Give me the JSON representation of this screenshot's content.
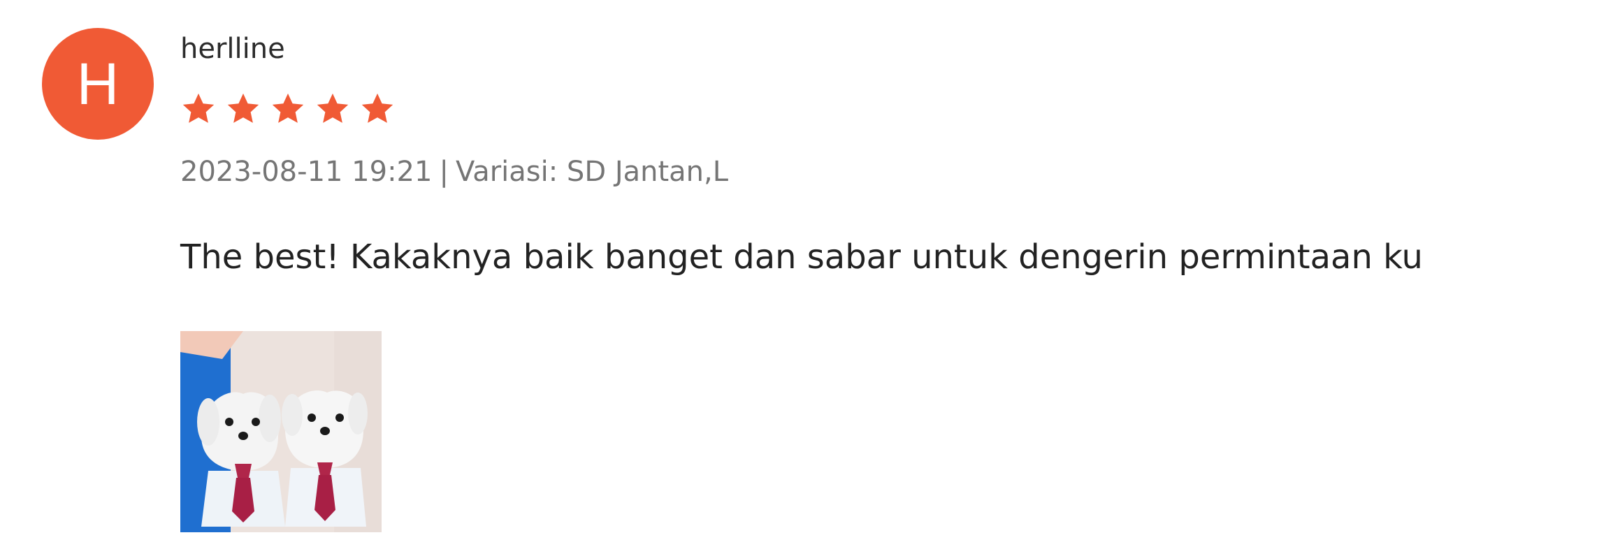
{
  "review": {
    "avatar_letter": "H",
    "username": "herlline",
    "rating": 5,
    "rating_max": 5,
    "date": "2023-08-11 19:21",
    "separator": "|",
    "variation": "Variasi: SD Jantan,L",
    "comment": "The best! Kakaknya baik banget dan sabar untuk dengerin permintaan ku",
    "photos": [
      {
        "description_icon": "photo-thumbnail"
      }
    ]
  },
  "colors": {
    "avatar_bg": "#f05a35",
    "star": "#f05a35",
    "meta_text": "#757575"
  }
}
